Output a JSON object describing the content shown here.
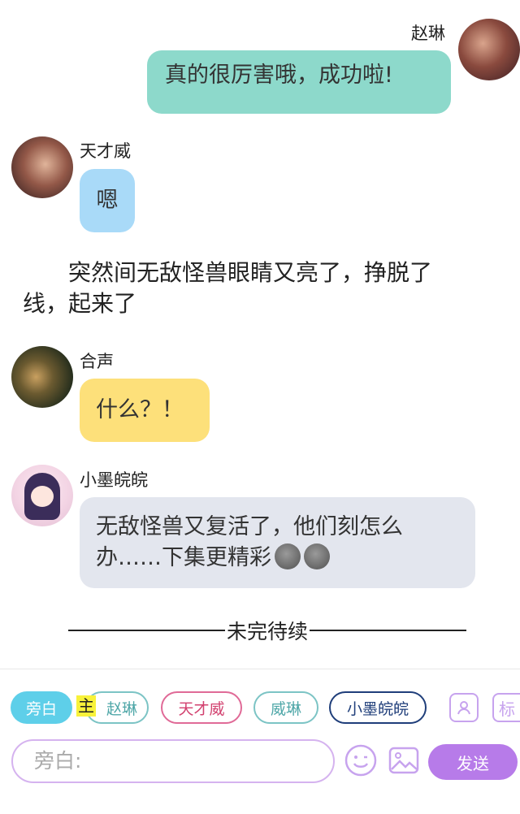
{
  "messages": [
    {
      "speaker": "赵琳",
      "text": "真的很厉害哦，成功啦!",
      "color": "#8dd9cb",
      "side": "right"
    },
    {
      "speaker": "天才威",
      "text": "嗯",
      "color": "#a9daf8",
      "side": "left"
    },
    {
      "speaker": "合声",
      "text": "什么？！",
      "color": "#fde07a",
      "side": "left"
    },
    {
      "speaker": "小墨皖皖",
      "text": "无敌怪兽又复活了，他们刻怎么办……下集更精彩",
      "color": "#e3e6ee",
      "side": "left"
    }
  ],
  "narration": {
    "line1": "突然间无敌怪兽眼睛又亮了，挣脱了",
    "line2": "线，起来了"
  },
  "divider_text": "未完待续",
  "bottom": {
    "chips": [
      {
        "label": "旁白",
        "style": "active",
        "color": "#5ecfe9"
      },
      {
        "label": "赵琳",
        "style": "outline",
        "color": "#7cc4c5"
      },
      {
        "label": "天才威",
        "style": "outline",
        "color": "#e06a97"
      },
      {
        "label": "威琳",
        "style": "outline",
        "color": "#7cc4c5"
      },
      {
        "label": "小墨皖皖",
        "style": "outline",
        "color": "#1f3e7a"
      }
    ],
    "badge": "主",
    "tool_tag": "标",
    "input_placeholder": "旁白:",
    "send_label": "发送"
  }
}
